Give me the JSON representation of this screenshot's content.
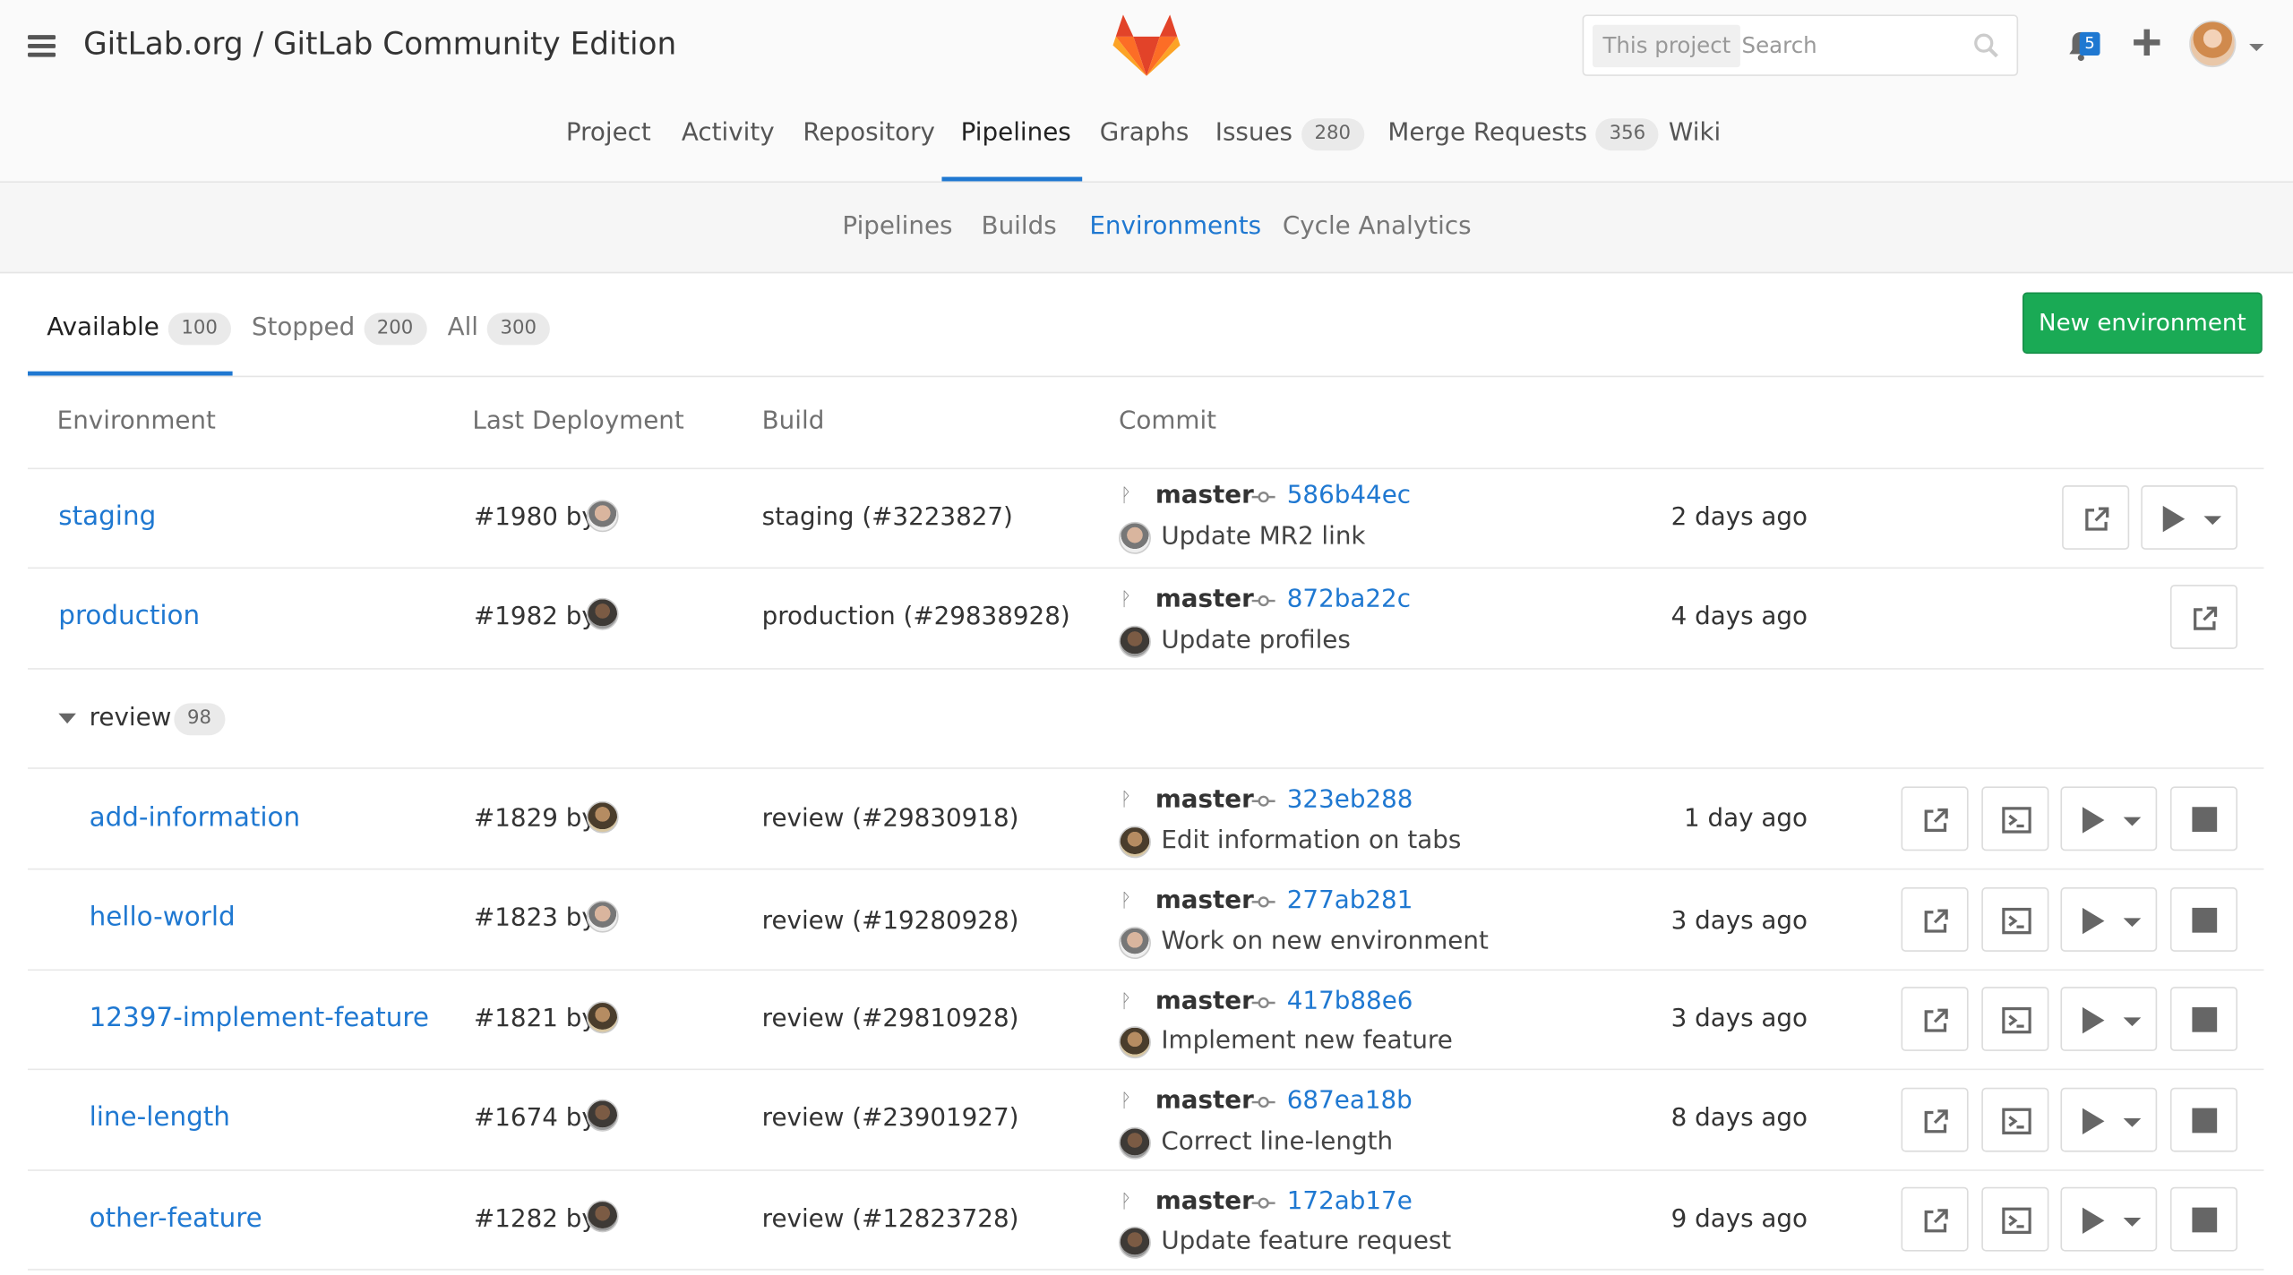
{
  "header": {
    "title": "GitLab.org / GitLab Community Edition",
    "search_scope": "This project",
    "search_placeholder": "Search",
    "notifications_count": "5",
    "icons": [
      "hamburger-icon",
      "gitlab-logo",
      "search-icon",
      "bell-icon",
      "plus-icon",
      "user-avatar",
      "chevron-down-icon"
    ]
  },
  "nav": {
    "project": "Project",
    "activity": "Activity",
    "repository": "Repository",
    "pipelines": "Pipelines",
    "graphs": "Graphs",
    "issues": "Issues",
    "issues_count": "280",
    "merge_requests": "Merge Requests",
    "merge_requests_count": "356",
    "wiki": "Wiki",
    "active": "Pipelines"
  },
  "subnav": {
    "pipelines": "Pipelines",
    "builds": "Builds",
    "environments": "Environments",
    "cycle_analytics": "Cycle Analytics",
    "active": "Environments"
  },
  "tabs": {
    "available": "Available",
    "available_count": "100",
    "stopped": "Stopped",
    "stopped_count": "200",
    "all": "All",
    "all_count": "300"
  },
  "new_environment_button": "New environment",
  "table": {
    "headers": {
      "environment": "Environment",
      "last_deployment": "Last Deployment",
      "build": "Build",
      "commit": "Commit"
    },
    "rows": [
      {
        "name": "staging",
        "deployment": "#1980 by",
        "build": "staging (#3223827)",
        "branch": "master",
        "sha": "586b44ec",
        "message": "Update MR2 link",
        "ago": "2 days ago"
      },
      {
        "name": "production",
        "deployment": "#1982 by",
        "build": "production (#29838928)",
        "branch": "master",
        "sha": "872ba22c",
        "message": "Update profiles",
        "ago": "4 days ago"
      }
    ],
    "group": {
      "name": "review",
      "count": "98"
    },
    "group_rows": [
      {
        "name": "add-information",
        "deployment": "#1829 by",
        "build": "review (#29830918)",
        "branch": "master",
        "sha": "323eb288",
        "message": "Edit information on tabs",
        "ago": "1 day ago"
      },
      {
        "name": "hello-world",
        "deployment": "#1823 by",
        "build": "review (#19280928)",
        "branch": "master",
        "sha": "277ab281",
        "message": "Work on new environment",
        "ago": "3 days ago"
      },
      {
        "name": "12397-implement-feature",
        "deployment": "#1821 by",
        "build": "review (#29810928)",
        "branch": "master",
        "sha": "417b88e6",
        "message": "Implement new feature",
        "ago": "3 days ago"
      },
      {
        "name": "line-length",
        "deployment": "#1674 by",
        "build": "review (#23901927)",
        "branch": "master",
        "sha": "687ea18b",
        "message": "Correct line-length",
        "ago": "8 days ago"
      },
      {
        "name": "other-feature",
        "deployment": "#1282 by",
        "build": "review (#12823728)",
        "branch": "master",
        "sha": "172ab17e",
        "message": "Update feature request",
        "ago": "9 days ago"
      }
    ]
  },
  "colors": {
    "accent": "#1f78d1",
    "create": "#1aaa55",
    "logo_orange": "#e24329",
    "logo_light": "#fc6d26",
    "logo_yellow": "#fca326"
  }
}
